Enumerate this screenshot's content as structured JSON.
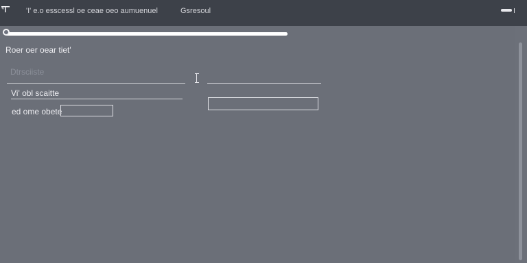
{
  "app": {
    "icon_name": "app-icon",
    "title": "'I' e.o esscessl oe ceae oeo aumuenuel",
    "secondary_title": "Gsresoul"
  },
  "window_control": {
    "icon_name": "window-minimize-icon"
  },
  "progress": {
    "value_percent": 100
  },
  "form": {
    "heading": "Roer oer oear tiet'",
    "fields": [
      {
        "label": "Dtrsciiste"
      },
      {
        "label": "Vi' obl scaitte"
      },
      {
        "label": "ed ome obete"
      }
    ],
    "small_input": {
      "value": "",
      "placeholder": ""
    },
    "large_input": {
      "value": "",
      "placeholder": ""
    }
  },
  "colors": {
    "background": "#6b6f78",
    "titlebar": "#3d4149",
    "text": "#ececf0",
    "muted_text": "#8b8f99",
    "line": "#d8d9de",
    "scrollbar_thumb": "#8e929b"
  }
}
